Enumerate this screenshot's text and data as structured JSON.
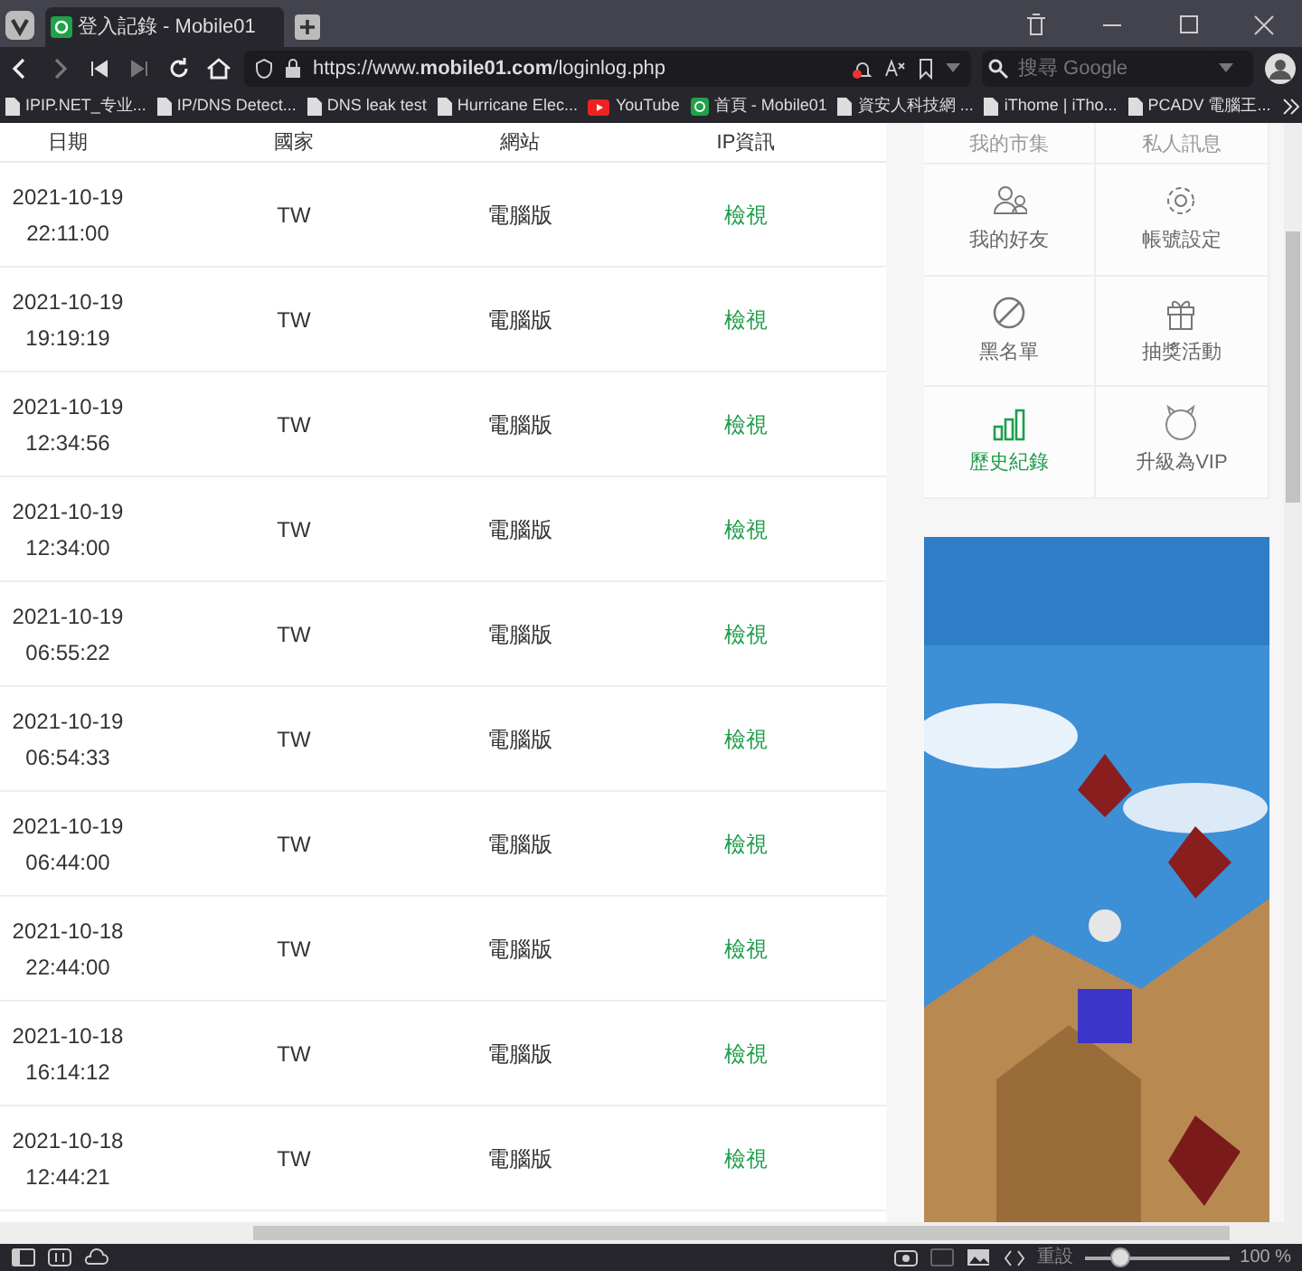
{
  "browser": {
    "tab_title": "登入記錄 - Mobile01",
    "url": "https://www.**mobile01.com**/loginlog.php",
    "search": {
      "placeholder": "搜尋 Google"
    },
    "bookmarks": [
      {
        "label": "IPIP.NET_专业...",
        "kind": "page"
      },
      {
        "label": "IP/DNS Detect...",
        "kind": "page"
      },
      {
        "label": "DNS leak test",
        "kind": "page"
      },
      {
        "label": "Hurricane Elec...",
        "kind": "page"
      },
      {
        "label": "YouTube",
        "kind": "youtube"
      },
      {
        "label": "首頁 - Mobile01",
        "kind": "m01"
      },
      {
        "label": "資安人科技網 ...",
        "kind": "page"
      },
      {
        "label": "iThome | iTho...",
        "kind": "page"
      },
      {
        "label": "PCADV 電腦王...",
        "kind": "page"
      }
    ],
    "status": {
      "reset": "重設",
      "zoom_slider": {
        "level": 0.25
      },
      "zoom": "100 %"
    }
  },
  "table": {
    "columns": [
      "日期",
      "國家",
      "網站",
      "IP資訊"
    ],
    "rows": [
      {
        "date": "2021-10-19",
        "time": "22:11:00",
        "country": "TW",
        "site": "電腦版",
        "ip": "檢視"
      },
      {
        "date": "2021-10-19",
        "time": "19:19:19",
        "country": "TW",
        "site": "電腦版",
        "ip": "檢視"
      },
      {
        "date": "2021-10-19",
        "time": "12:34:56",
        "country": "TW",
        "site": "電腦版",
        "ip": "檢視"
      },
      {
        "date": "2021-10-19",
        "time": "12:34:00",
        "country": "TW",
        "site": "電腦版",
        "ip": "檢視"
      },
      {
        "date": "2021-10-19",
        "time": "06:55:22",
        "country": "TW",
        "site": "電腦版",
        "ip": "檢視"
      },
      {
        "date": "2021-10-19",
        "time": "06:54:33",
        "country": "TW",
        "site": "電腦版",
        "ip": "檢視"
      },
      {
        "date": "2021-10-19",
        "time": "06:44:00",
        "country": "TW",
        "site": "電腦版",
        "ip": "檢視"
      },
      {
        "date": "2021-10-18",
        "time": "22:44:00",
        "country": "TW",
        "site": "電腦版",
        "ip": "檢視"
      },
      {
        "date": "2021-10-18",
        "time": "16:14:12",
        "country": "TW",
        "site": "電腦版",
        "ip": "檢視"
      },
      {
        "date": "2021-10-18",
        "time": "12:44:21",
        "country": "TW",
        "site": "電腦版",
        "ip": "檢視"
      }
    ]
  },
  "sidebar": {
    "items": [
      {
        "label": "我的市集",
        "kind": "cut",
        "selected": false
      },
      {
        "label": "私人訊息",
        "kind": "cut",
        "selected": false
      },
      {
        "label": "我的好友",
        "kind": "friends",
        "selected": false
      },
      {
        "label": "帳號設定",
        "kind": "settings",
        "selected": false
      },
      {
        "label": "黑名單",
        "kind": "block",
        "selected": false
      },
      {
        "label": "抽獎活動",
        "kind": "gift",
        "selected": false
      },
      {
        "label": "歷史紀錄",
        "kind": "history",
        "selected": true
      },
      {
        "label": "升級為VIP",
        "kind": "vip",
        "selected": false
      }
    ]
  }
}
